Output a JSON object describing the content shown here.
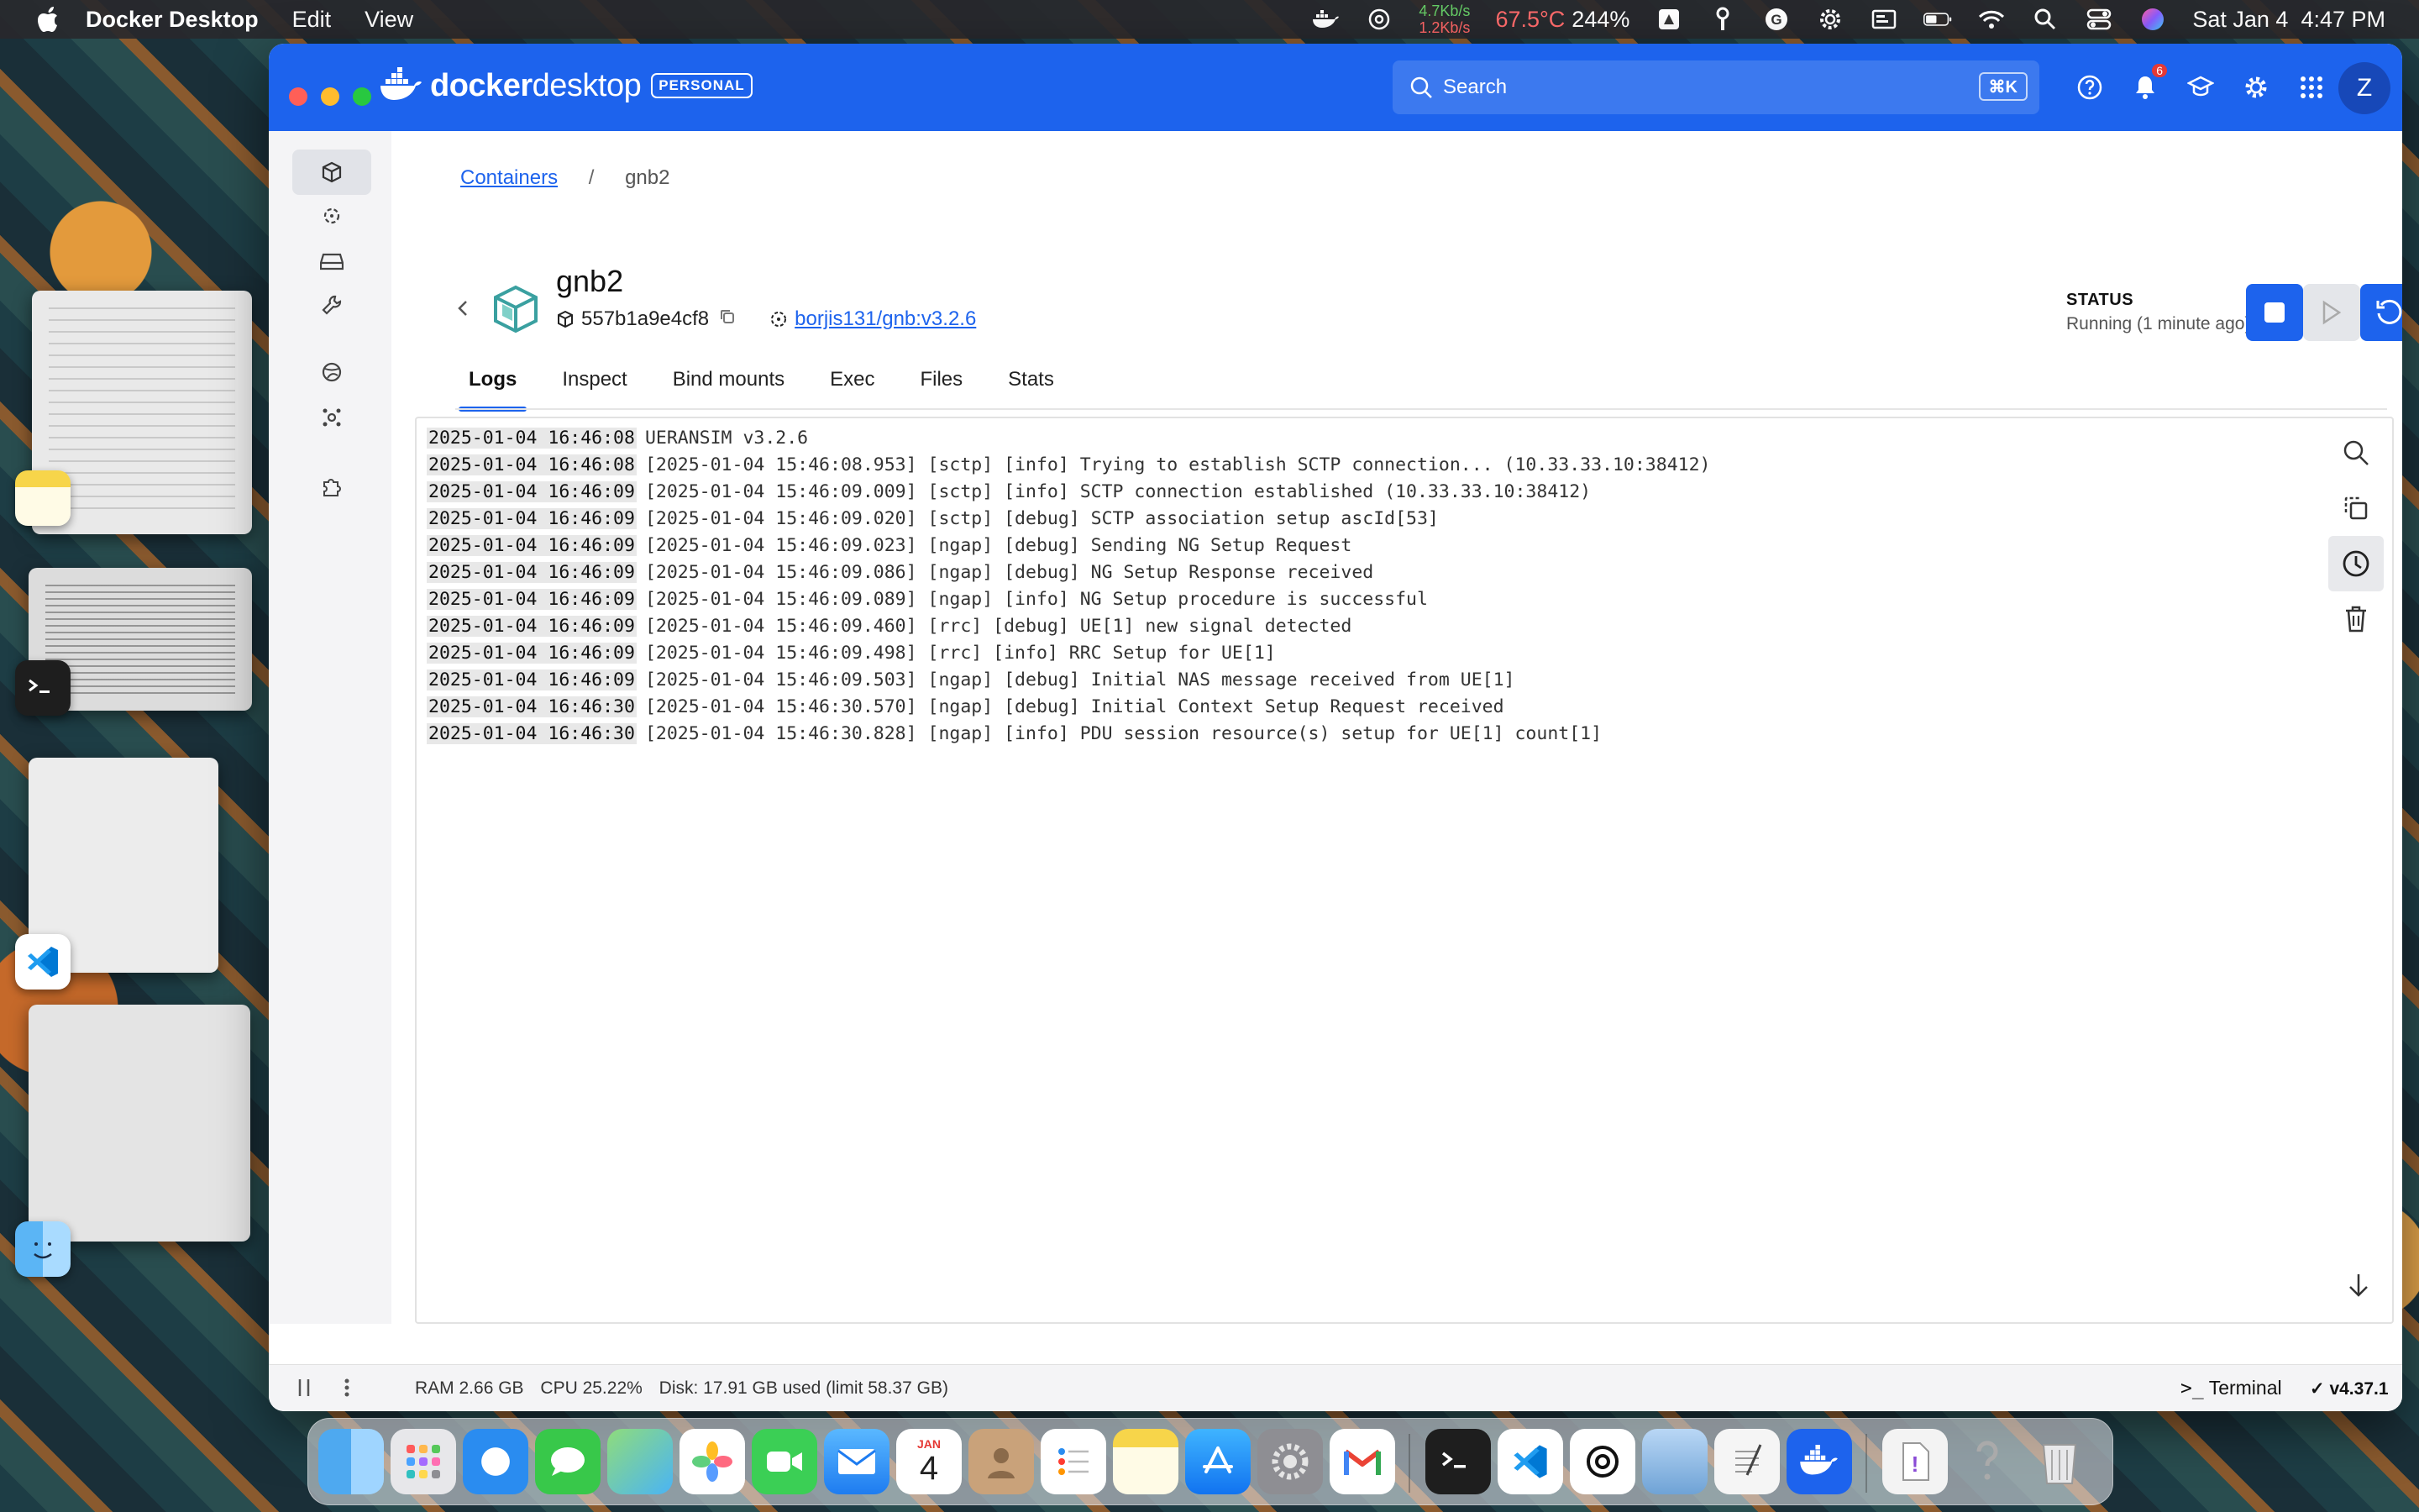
{
  "menubar": {
    "app_name": "Docker Desktop",
    "menus": [
      "Edit",
      "View"
    ],
    "net_up": "4.7Kb/s",
    "net_down": "1.2Kb/s",
    "temp": "67.5°C",
    "cpu": "244%",
    "datetime": "Sat Jan 4  4:47 PM"
  },
  "titlebar": {
    "brand_bold": "docker",
    "brand_light": "desktop",
    "plan_badge": "PERSONAL",
    "search_placeholder": "Search",
    "search_shortcut": "⌘K",
    "notification_count": "6",
    "avatar_initial": "Z"
  },
  "breadcrumb": {
    "parent": "Containers",
    "current": "gnb2"
  },
  "container": {
    "name": "gnb2",
    "id": "557b1a9e4cf8",
    "image": "borjis131/gnb:v3.2.6",
    "status_label": "STATUS",
    "status_value": "Running (1 minute ago)"
  },
  "tabs": [
    "Logs",
    "Inspect",
    "Bind mounts",
    "Exec",
    "Files",
    "Stats"
  ],
  "active_tab": "Logs",
  "logs": [
    {
      "ts": "2025-01-04 16:46:08",
      "msg": "UERANSIM v3.2.6"
    },
    {
      "ts": "2025-01-04 16:46:08",
      "msg": "[2025-01-04 15:46:08.953] [sctp] [info] Trying to establish SCTP connection... (10.33.33.10:38412)"
    },
    {
      "ts": "2025-01-04 16:46:09",
      "msg": "[2025-01-04 15:46:09.009] [sctp] [info] SCTP connection established (10.33.33.10:38412)"
    },
    {
      "ts": "2025-01-04 16:46:09",
      "msg": "[2025-01-04 15:46:09.020] [sctp] [debug] SCTP association setup ascId[53]"
    },
    {
      "ts": "2025-01-04 16:46:09",
      "msg": "[2025-01-04 15:46:09.023] [ngap] [debug] Sending NG Setup Request"
    },
    {
      "ts": "2025-01-04 16:46:09",
      "msg": "[2025-01-04 15:46:09.086] [ngap] [debug] NG Setup Response received"
    },
    {
      "ts": "2025-01-04 16:46:09",
      "msg": "[2025-01-04 15:46:09.089] [ngap] [info] NG Setup procedure is successful"
    },
    {
      "ts": "2025-01-04 16:46:09",
      "msg": "[2025-01-04 15:46:09.460] [rrc] [debug] UE[1] new signal detected"
    },
    {
      "ts": "2025-01-04 16:46:09",
      "msg": "[2025-01-04 15:46:09.498] [rrc] [info] RRC Setup for UE[1]"
    },
    {
      "ts": "2025-01-04 16:46:09",
      "msg": "[2025-01-04 15:46:09.503] [ngap] [debug] Initial NAS message received from UE[1]"
    },
    {
      "ts": "2025-01-04 16:46:30",
      "msg": "[2025-01-04 15:46:30.570] [ngap] [debug] Initial Context Setup Request received"
    },
    {
      "ts": "2025-01-04 16:46:30",
      "msg": "[2025-01-04 15:46:30.828] [ngap] [info] PDU session resource(s) setup for UE[1] count[1]"
    }
  ],
  "footer": {
    "ram": "RAM 2.66 GB",
    "cpu": "CPU 25.22%",
    "disk": "Disk: 17.91 GB used (limit 58.37 GB)",
    "terminal": "Terminal",
    "version": "v4.37.1"
  },
  "dock": {
    "calendar_month": "JAN",
    "calendar_day": "4"
  },
  "colors": {
    "docker_blue": "#1d63ed",
    "delete_red": "#d32f2f"
  }
}
